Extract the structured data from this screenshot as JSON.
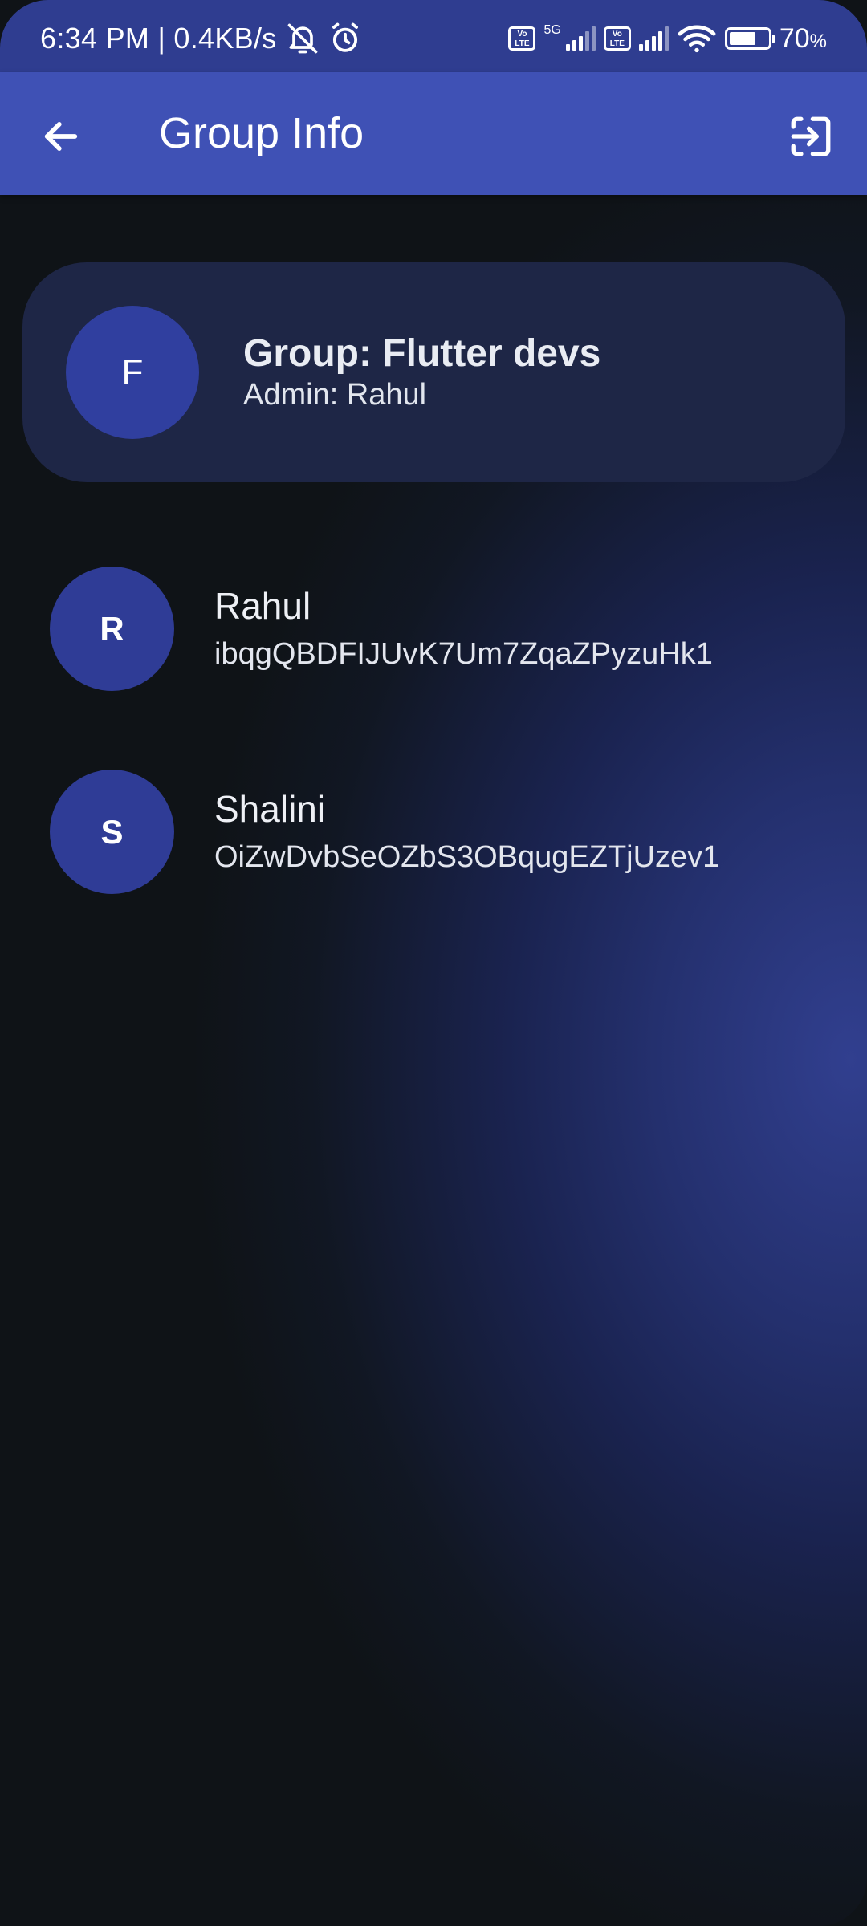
{
  "status_bar": {
    "time_speed": "6:34 PM | 0.4KB/s",
    "network_5g": "5G",
    "volte_label": "Vo LTE",
    "battery_percent": "70",
    "battery_unit": "%",
    "battery_level": 0.7,
    "icons": [
      "mute-bell-icon",
      "alarm-icon",
      "volte-icon",
      "signal-icon",
      "wifi-icon",
      "battery-icon"
    ]
  },
  "app_bar": {
    "title": "Group Info",
    "icons": [
      "back-arrow-icon",
      "exit-icon"
    ]
  },
  "group": {
    "avatar_letter": "F",
    "name": "Group: Flutter devs",
    "admin": "Admin: Rahul"
  },
  "members": [
    {
      "initial": "R",
      "name": "Rahul",
      "id": "ibqgQBDFIJUvK7Um7ZqaZPyzuHk1"
    },
    {
      "initial": "S",
      "name": "Shalini",
      "id": "OiZwDvbSeOZbS3OBqugEZTjUzev1"
    }
  ],
  "colors": {
    "app_bar": "#3f51b5",
    "status_bar": "#2f3d90",
    "avatar": "#303f9f",
    "card": "#1e2646",
    "background": "#0f1317"
  }
}
